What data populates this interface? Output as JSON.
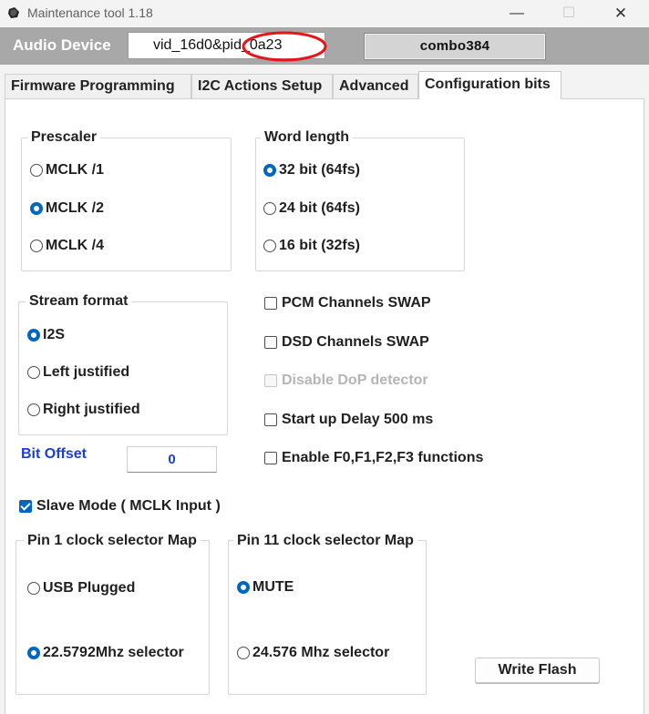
{
  "window": {
    "title": "Maintenance tool 1.18",
    "minimize_glyph": "—",
    "maximize_glyph": "☐",
    "close_glyph": "✕"
  },
  "device_bar": {
    "label": "Audio Device",
    "device_id": "vid_16d0&pid_0a23",
    "device_name": "combo384",
    "highlight_color": "#e8141b"
  },
  "tabs": [
    {
      "label": "Firmware Programming",
      "active": false
    },
    {
      "label": "I2C Actions Setup",
      "active": false
    },
    {
      "label": "Advanced",
      "active": false
    },
    {
      "label": "Configuration bits",
      "active": true
    }
  ],
  "prescaler": {
    "title": "Prescaler",
    "options": [
      {
        "label": "MCLK /1",
        "selected": false
      },
      {
        "label": "MCLK /2",
        "selected": true
      },
      {
        "label": "MCLK /4",
        "selected": false
      }
    ]
  },
  "word_length": {
    "title": "Word length",
    "options": [
      {
        "label": "32 bit (64fs)",
        "selected": true
      },
      {
        "label": "24 bit (64fs)",
        "selected": false
      },
      {
        "label": "16 bit (32fs)",
        "selected": false
      }
    ]
  },
  "stream_format": {
    "title": "Stream format",
    "options": [
      {
        "label": "I2S",
        "selected": true
      },
      {
        "label": "Left justified",
        "selected": false
      },
      {
        "label": "Right justified",
        "selected": false
      }
    ]
  },
  "checkboxes": [
    {
      "label": "PCM Channels SWAP",
      "checked": false,
      "enabled": true
    },
    {
      "label": "DSD Channels SWAP",
      "checked": false,
      "enabled": true
    },
    {
      "label": "Disable DoP detector",
      "checked": false,
      "enabled": false
    },
    {
      "label": "Start up Delay 500 ms",
      "checked": false,
      "enabled": true
    },
    {
      "label": "Enable F0,F1,F2,F3 functions",
      "checked": false,
      "enabled": true
    }
  ],
  "bit_offset": {
    "label": "Bit Offset",
    "value": "0",
    "color": "#1a3fd9"
  },
  "slave_mode": {
    "label": "Slave Mode ( MCLK Input )",
    "checked": true
  },
  "pin1": {
    "title": "Pin 1 clock selector Map",
    "options": [
      {
        "label": "USB Plugged",
        "selected": false
      },
      {
        "label": "22.5792Mhz selector",
        "selected": true
      }
    ]
  },
  "pin11": {
    "title": "Pin 11 clock selector Map",
    "options": [
      {
        "label": "MUTE",
        "selected": true
      },
      {
        "label": "24.576 Mhz selector",
        "selected": false
      }
    ]
  },
  "write_flash_label": "Write Flash",
  "accent_color": "#0067c0"
}
